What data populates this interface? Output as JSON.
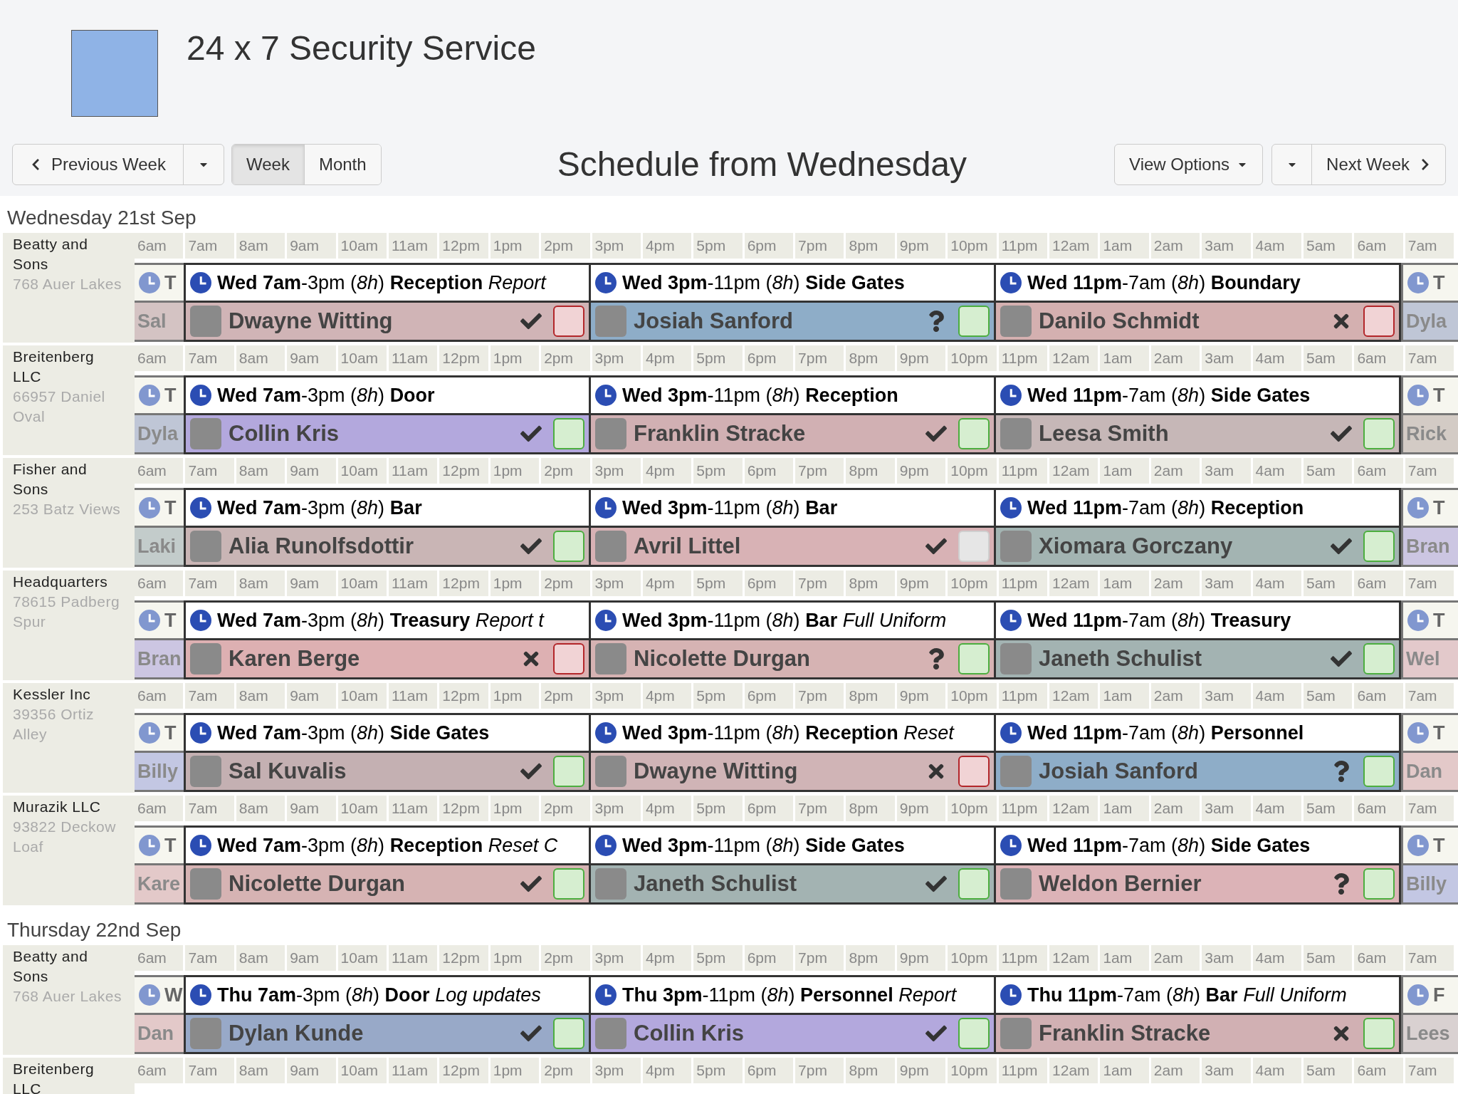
{
  "header": {
    "title": "24 x 7 Security Service"
  },
  "toolbar": {
    "previous": "Previous Week",
    "views": [
      {
        "label": "Week",
        "selected": true
      },
      {
        "label": "Month",
        "selected": false
      }
    ],
    "title": "Schedule from Wednesday",
    "view_options": "View Options",
    "next": "Next Week"
  },
  "days": [
    {
      "heading": "Wednesday 21st Sep",
      "rows": [
        {
          "site": "Beatty and Sons",
          "address": "768 Auer Lakes",
          "hours": [
            "6am",
            "7am",
            "8am",
            "9am",
            "10am",
            "11am",
            "12pm",
            "1pm",
            "2pm",
            "3pm",
            "4pm",
            "5pm",
            "6pm",
            "7pm",
            "8pm",
            "9pm",
            "10pm",
            "11pm",
            "12am",
            "1am",
            "2am",
            "3am",
            "4am",
            "5am",
            "6am",
            "7am"
          ],
          "leading": {
            "label": "T",
            "name": "Sal",
            "color": "#d4c3c3"
          },
          "shifts": [
            {
              "time": "**Wed 7am**-3pm (*8h*)",
              "post": "Reception",
              "note": "Report",
              "employee": "Dwayne Witting",
              "color": "#d0b4b6",
              "status": {
                "kind": "approved"
              },
              "confirmation": {
                "kind": "declined"
              }
            },
            {
              "time": "**Wed 3pm**-11pm (*8h*)",
              "post": "Side Gates",
              "employee": "Josiah Sanford",
              "color": "#8eadc8",
              "status": {
                "kind": "unknown"
              },
              "confirmation": {
                "kind": "confirmed"
              }
            },
            {
              "time": "**Wed 11pm**-7am (*8h*)",
              "post": "Boundary",
              "employee": "Danilo Schmidt",
              "color": "#d4b0b0",
              "status": {
                "kind": "declined"
              },
              "confirmation": {
                "kind": "declined"
              }
            }
          ],
          "trailing": {
            "label": "T",
            "name": "Dyla",
            "color": "#bfc6d6"
          }
        },
        {
          "site": "Breitenberg LLC",
          "address": "66957 Daniel Oval",
          "hours": [
            "6am",
            "7am",
            "8am",
            "9am",
            "10am",
            "11am",
            "12pm",
            "1pm",
            "2pm",
            "3pm",
            "4pm",
            "5pm",
            "6pm",
            "7pm",
            "8pm",
            "9pm",
            "10pm",
            "11pm",
            "12am",
            "1am",
            "2am",
            "3am",
            "4am",
            "5am",
            "6am",
            "7am"
          ],
          "leading": {
            "label": "T",
            "name": "Dyla",
            "color": "#bfc6d6"
          },
          "shifts": [
            {
              "time": "**Wed 7am**-3pm (*8h*)",
              "post": "Door",
              "employee": "Collin Kris",
              "color": "#b3a8dd",
              "status": {
                "kind": "approved"
              },
              "confirmation": {
                "kind": "confirmed"
              }
            },
            {
              "time": "**Wed 3pm**-11pm (*8h*)",
              "post": "Reception",
              "employee": "Franklin Stracke",
              "color": "#d1b0b3",
              "status": {
                "kind": "approved"
              },
              "confirmation": {
                "kind": "confirmed"
              }
            },
            {
              "time": "**Wed 11pm**-7am (*8h*)",
              "post": "Side Gates",
              "employee": "Leesa Smith",
              "color": "#c6b7b7",
              "status": {
                "kind": "approved"
              },
              "confirmation": {
                "kind": "confirmed"
              }
            }
          ],
          "trailing": {
            "label": "T",
            "name": "Rick",
            "color": "#d3cbc5"
          }
        },
        {
          "site": "Fisher and Sons",
          "address": "253 Batz Views",
          "hours": [
            "6am",
            "7am",
            "8am",
            "9am",
            "10am",
            "11am",
            "12pm",
            "1pm",
            "2pm",
            "3pm",
            "4pm",
            "5pm",
            "6pm",
            "7pm",
            "8pm",
            "9pm",
            "10pm",
            "11pm",
            "12am",
            "1am",
            "2am",
            "3am",
            "4am",
            "5am",
            "6am",
            "7am"
          ],
          "leading": {
            "label": "T",
            "name": "Laki",
            "color": "#c3cccb"
          },
          "shifts": [
            {
              "time": "**Wed 7am**-3pm (*8h*)",
              "post": "Bar",
              "employee": "Alia Runolfsdottir",
              "color": "#c9b5b5",
              "status": {
                "kind": "approved"
              },
              "confirmation": {
                "kind": "confirmed"
              }
            },
            {
              "time": "**Wed 3pm**-11pm (*8h*)",
              "post": "Bar",
              "employee": "Avril Littel",
              "color": "#d8b2b5",
              "status": {
                "kind": "approved"
              },
              "confirmation": {
                "kind": "pending"
              }
            },
            {
              "time": "**Wed 11pm**-7am (*8h*)",
              "post": "Reception",
              "employee": "Xiomara Gorczany",
              "color": "#a3b4b2",
              "status": {
                "kind": "approved"
              },
              "confirmation": {
                "kind": "confirmed"
              }
            }
          ],
          "trailing": {
            "label": "T",
            "name": "Bran",
            "color": "#ccc6e2"
          }
        },
        {
          "site": "Headquarters",
          "address": "78615 Padberg Spur",
          "hours": [
            "6am",
            "7am",
            "8am",
            "9am",
            "10am",
            "11am",
            "12pm",
            "1pm",
            "2pm",
            "3pm",
            "4pm",
            "5pm",
            "6pm",
            "7pm",
            "8pm",
            "9pm",
            "10pm",
            "11pm",
            "12am",
            "1am",
            "2am",
            "3am",
            "4am",
            "5am",
            "6am",
            "7am"
          ],
          "leading": {
            "label": "T",
            "name": "Bran",
            "color": "#ccc6e2"
          },
          "shifts": [
            {
              "time": "**Wed 7am**-3pm (*8h*)",
              "post": "Treasury",
              "note": "Report t",
              "employee": "Karen Berge",
              "color": "#ddb0b2",
              "status": {
                "kind": "declined"
              },
              "confirmation": {
                "kind": "declined"
              }
            },
            {
              "time": "**Wed 3pm**-11pm (*8h*)",
              "post": "Bar",
              "note": "Full Uniform",
              "employee": "Nicolette Durgan",
              "color": "#d6b3b3",
              "status": {
                "kind": "unknown"
              },
              "confirmation": {
                "kind": "confirmed"
              }
            },
            {
              "time": "**Wed 11pm**-7am (*8h*)",
              "post": "Treasury",
              "employee": "Janeth Schulist",
              "color": "#a3b3b2",
              "status": {
                "kind": "approved"
              },
              "confirmation": {
                "kind": "confirmed"
              }
            }
          ],
          "trailing": {
            "label": "T",
            "name": "Wel",
            "color": "#e3c9cb"
          }
        },
        {
          "site": "Kessler Inc",
          "address": "39356 Ortiz Alley",
          "hours": [
            "6am",
            "7am",
            "8am",
            "9am",
            "10am",
            "11am",
            "12pm",
            "1pm",
            "2pm",
            "3pm",
            "4pm",
            "5pm",
            "6pm",
            "7pm",
            "8pm",
            "9pm",
            "10pm",
            "11pm",
            "12am",
            "1am",
            "2am",
            "3am",
            "4am",
            "5am",
            "6am",
            "7am"
          ],
          "leading": {
            "label": "T",
            "name": "Billy",
            "color": "#c3c7e3"
          },
          "shifts": [
            {
              "time": "**Wed 7am**-3pm (*8h*)",
              "post": "Side Gates",
              "employee": "Sal Kuvalis",
              "color": "#c4b0b2",
              "status": {
                "kind": "approved"
              },
              "confirmation": {
                "kind": "confirmed"
              }
            },
            {
              "time": "**Wed 3pm**-11pm (*8h*)",
              "post": "Reception",
              "note": "Reset",
              "employee": "Dwayne Witting",
              "color": "#d0b4b6",
              "status": {
                "kind": "declined"
              },
              "confirmation": {
                "kind": "declined"
              }
            },
            {
              "time": "**Wed 11pm**-7am (*8h*)",
              "post": "Personnel",
              "employee": "Josiah Sanford",
              "color": "#8eadc8",
              "status": {
                "kind": "unknown"
              },
              "confirmation": {
                "kind": "confirmed"
              }
            }
          ],
          "trailing": {
            "label": "T",
            "name": "Dan",
            "color": "#e3c9c9"
          }
        },
        {
          "site": "Murazik LLC",
          "address": "93822 Deckow Loaf",
          "hours": [
            "6am",
            "7am",
            "8am",
            "9am",
            "10am",
            "11am",
            "12pm",
            "1pm",
            "2pm",
            "3pm",
            "4pm",
            "5pm",
            "6pm",
            "7pm",
            "8pm",
            "9pm",
            "10pm",
            "11pm",
            "12am",
            "1am",
            "2am",
            "3am",
            "4am",
            "5am",
            "6am",
            "7am"
          ],
          "leading": {
            "label": "T",
            "name": "Kare",
            "color": "#e3c9c9"
          },
          "shifts": [
            {
              "time": "**Wed 7am**-3pm (*8h*)",
              "post": "Reception",
              "note": "Reset C",
              "employee": "Nicolette Durgan",
              "color": "#d6b3b3",
              "status": {
                "kind": "approved"
              },
              "confirmation": {
                "kind": "confirmed"
              }
            },
            {
              "time": "**Wed 3pm**-11pm (*8h*)",
              "post": "Side Gates",
              "employee": "Janeth Schulist",
              "color": "#a3b3b2",
              "status": {
                "kind": "approved"
              },
              "confirmation": {
                "kind": "confirmed"
              }
            },
            {
              "time": "**Wed 11pm**-7am (*8h*)",
              "post": "Side Gates",
              "employee": "Weldon Bernier",
              "color": "#dcb3b7",
              "status": {
                "kind": "unknown"
              },
              "confirmation": {
                "kind": "confirmed"
              }
            }
          ],
          "trailing": {
            "label": "T",
            "name": "Billy",
            "color": "#c3c7e3"
          }
        }
      ]
    },
    {
      "heading": "Thursday 22nd Sep",
      "rows": [
        {
          "site": "Beatty and Sons",
          "address": "768 Auer Lakes",
          "hours": [
            "6am",
            "7am",
            "8am",
            "9am",
            "10am",
            "11am",
            "12pm",
            "1pm",
            "2pm",
            "3pm",
            "4pm",
            "5pm",
            "6pm",
            "7pm",
            "8pm",
            "9pm",
            "10pm",
            "11pm",
            "12am",
            "1am",
            "2am",
            "3am",
            "4am",
            "5am",
            "6am",
            "7am"
          ],
          "leading": {
            "label": "W",
            "name": "Dan",
            "color": "#e3c9c9"
          },
          "shifts": [
            {
              "time": "**Thu 7am**-3pm (*8h*)",
              "post": "Door",
              "note": "Log updates",
              "employee": "Dylan Kunde",
              "color": "#98a9c8",
              "status": {
                "kind": "approved"
              },
              "confirmation": {
                "kind": "confirmed"
              }
            },
            {
              "time": "**Thu 3pm**-11pm (*8h*)",
              "post": "Personnel",
              "note": "Report",
              "employee": "Collin Kris",
              "color": "#b3a8dd",
              "status": {
                "kind": "approved"
              },
              "confirmation": {
                "kind": "confirmed"
              }
            },
            {
              "time": "**Thu 11pm**-7am (*8h*)",
              "post": "Bar",
              "note": "Full Uniform",
              "employee": "Franklin Stracke",
              "color": "#d1b0b3",
              "status": {
                "kind": "declined"
              },
              "confirmation": {
                "kind": "confirmed"
              }
            }
          ],
          "trailing": {
            "label": "F",
            "name": "Lees",
            "color": "#d9d1d1"
          }
        },
        {
          "site": "Breitenberg LLC",
          "hours": [
            "6am",
            "7am",
            "8am",
            "9am",
            "10am",
            "11am",
            "12pm",
            "1pm",
            "2pm",
            "3pm",
            "4pm",
            "5pm",
            "6pm",
            "7pm",
            "8pm",
            "9pm",
            "10pm",
            "11pm",
            "12am",
            "1am",
            "2am",
            "3am",
            "4am",
            "5am",
            "6am",
            "7am"
          ]
        }
      ]
    }
  ]
}
